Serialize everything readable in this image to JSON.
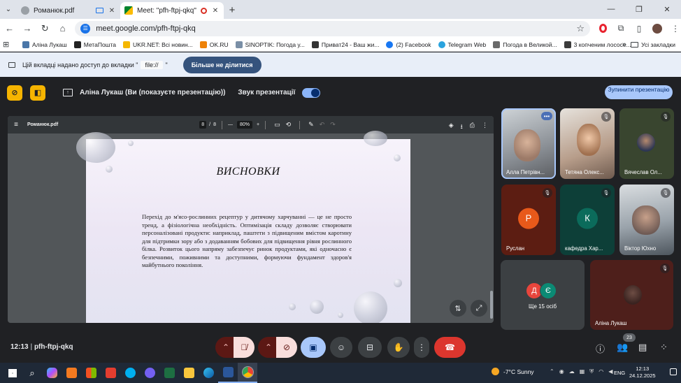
{
  "browser": {
    "tabs": [
      {
        "label": "Романюк.pdf",
        "active": false
      },
      {
        "label": "Meet: \"pfh-ftpj-qkq\"",
        "active": true
      }
    ],
    "url": "meet.google.com/pfh-ftpj-qkq",
    "bookmarks": [
      {
        "label": "Аліна Лукаш",
        "color": "#4a76a8"
      },
      {
        "label": "МетаПошта",
        "color": "#222222"
      },
      {
        "label": "UKR.NET: Всі новин...",
        "color": "#f5b700"
      },
      {
        "label": "OK.RU",
        "color": "#ee8208"
      },
      {
        "label": "SINOPTIK: Погода у...",
        "color": "#7a8fa6"
      },
      {
        "label": "Приват24 - Ваш жи...",
        "color": "#333333"
      },
      {
        "label": "(2) Facebook",
        "color": "#1877f2"
      },
      {
        "label": "Telegram Web",
        "color": "#2aa3de"
      },
      {
        "label": "Погода в Великой...",
        "color": "#6a6a6a"
      },
      {
        "label": "3 копченим лососе...",
        "color": "#3b3b3b"
      }
    ],
    "bookmarks_all": "Усі закладки"
  },
  "sharebar": {
    "message_prefix": "Цій вкладці надано доступ до вкладки \"",
    "message_file": "file://",
    "message_suffix": "\"",
    "stop_label": "Більше не ділитися"
  },
  "meet_top": {
    "presenting_title": "Аліна Лукаш (Ви (показуєте презентацію))",
    "sound_label": "Звук презентації",
    "stop_label": "Зупинити презентацію"
  },
  "pdf": {
    "filename": "Романюк.pdf",
    "page_current": "8",
    "page_sep": "/",
    "page_total": "8",
    "zoom": "80%",
    "slide_title": "ВИСНОВКИ",
    "slide_body": "Перехід до м'ясо-рослинних рецептур у дитячому харчуванні — це не просто тренд, а фізіологічна необхідність. Оптимізація складу дозволяє створювати персоналізовані продукти: наприклад, паштети з підвищеним вмістом каротину для підтримки зору або з додаванням бобових для підвищення рівня рослинного білка. Розвиток цього напряму забезпечує ринок продуктами, які одночасно є безпечними, поживними та доступними, формуючи фундамент здоров'я майбутнього покоління."
  },
  "participants": [
    {
      "name": "Алла Петрівн...",
      "type": "video",
      "color": "#7b8a96"
    },
    {
      "name": "Тетяна Олекс...",
      "type": "video",
      "color": "#b98b74"
    },
    {
      "name": "Вячеслав Ол...",
      "type": "video",
      "color": "#3a4a32"
    },
    {
      "name": "Руслан",
      "type": "avatar",
      "initial": "Р",
      "color": "#e8591a",
      "bg": "#5c1d12"
    },
    {
      "name": "кафедра Хар...",
      "type": "avatar",
      "initial": "К",
      "color": "#0b6b5b",
      "bg": "#0d3f38"
    },
    {
      "name": "Віктор Юхно",
      "type": "video",
      "color": "#9aa3ab"
    }
  ],
  "others": {
    "initials": [
      "Д",
      "Є"
    ],
    "colors": [
      "#e8453c",
      "#0b8a74"
    ],
    "label": "Ще 15 осіб"
  },
  "self_tile": {
    "name": "Аліна Лукаш"
  },
  "controls": {
    "time": "12:13",
    "separator": "|",
    "meeting_code": "pfh-ftpj-qkq",
    "participant_count": "23"
  },
  "taskbar": {
    "weather": "-7°C  Sunny",
    "lang": "ENG",
    "time": "12:13",
    "date": "24.12.2025"
  }
}
